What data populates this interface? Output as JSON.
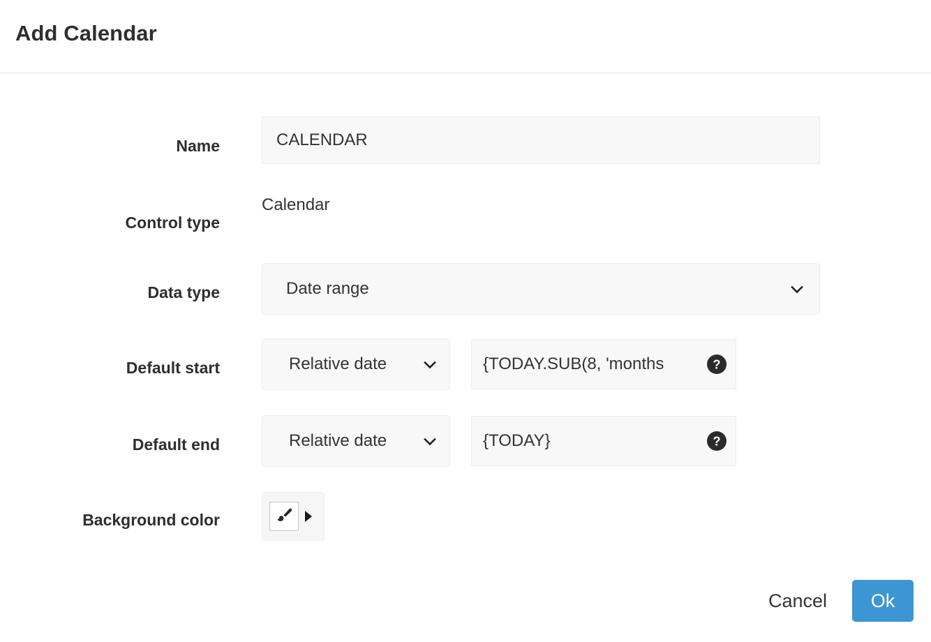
{
  "dialog": {
    "title": "Add Calendar"
  },
  "form": {
    "name": {
      "label": "Name",
      "value": "CALENDAR",
      "placeholder": ""
    },
    "control_type": {
      "label": "Control type",
      "value": "Calendar"
    },
    "data_type": {
      "label": "Data type",
      "selected": "Date range",
      "chevron_icon": "chevron-down-icon"
    },
    "default_start": {
      "label": "Default start",
      "mode_selected": "Relative date",
      "expression": "{TODAY.SUB(8, 'months",
      "help_icon": "help-circle-icon"
    },
    "default_end": {
      "label": "Default end",
      "mode_selected": "Relative date",
      "expression": "{TODAY}",
      "help_icon": "help-circle-icon"
    },
    "background_color": {
      "label": "Background color",
      "brush_icon": "paint-brush-icon",
      "caret_icon": "caret-right-icon"
    }
  },
  "footer": {
    "cancel_label": "Cancel",
    "ok_label": "Ok"
  },
  "colors": {
    "accent": "#3d95d3",
    "field_bg": "#f8f8f8",
    "field_border": "#ededed",
    "text": "#333333",
    "divider": "#e7e7e7"
  }
}
